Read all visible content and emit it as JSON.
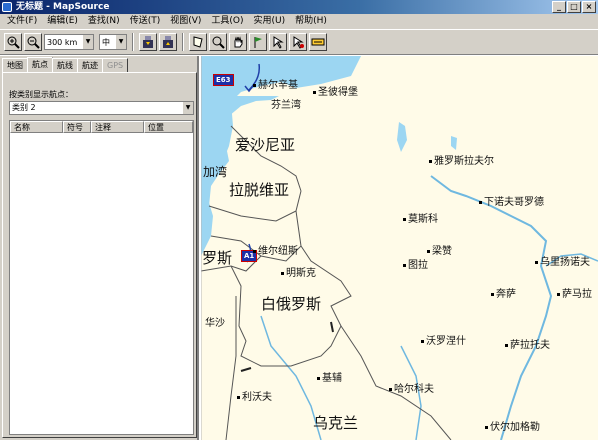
{
  "window": {
    "title": "无标题 - MapSource",
    "min": "_",
    "max": "□",
    "close": "×"
  },
  "menu": [
    "文件(F)",
    "编辑(E)",
    "查找(N)",
    "传送(T)",
    "视图(V)",
    "工具(O)",
    "实用(U)",
    "帮助(H)"
  ],
  "toolbar": {
    "zoom_value": "300 km",
    "detail_value": "中",
    "icons": [
      "zoom-in-icon",
      "zoom-out-icon",
      "receive-icon",
      "send-icon",
      "map-tool-icon",
      "zoom-tool-icon",
      "hand-tool-icon",
      "waypoint-tool-icon",
      "route-tool-icon",
      "measure-tool-icon",
      "map-info-icon"
    ]
  },
  "tabs": [
    {
      "label": "地图",
      "active": false,
      "disabled": false
    },
    {
      "label": "航点",
      "active": true,
      "disabled": false
    },
    {
      "label": "航线",
      "active": false,
      "disabled": false
    },
    {
      "label": "航迹",
      "active": false,
      "disabled": false
    },
    {
      "label": "GPS",
      "active": false,
      "disabled": true
    }
  ],
  "waypoints_panel": {
    "group_label": "按类别显示航点：",
    "group_value": "类别 2",
    "columns": [
      "名称",
      "符号",
      "注释",
      "位置"
    ]
  },
  "map": {
    "colors": {
      "land": "#fffbe8",
      "water": "#9cd6f2",
      "border": "#555555",
      "frame": "#b7b7b7"
    },
    "labels": [
      {
        "text": "赫尔辛基"
      },
      {
        "text": "芬兰湾"
      },
      {
        "text": "圣彼得堡"
      },
      {
        "text": "爱沙尼亚"
      },
      {
        "text": "雅罗斯拉夫尔"
      },
      {
        "text": "加湾"
      },
      {
        "text": "拉脱维亚"
      },
      {
        "text": "下诺夫哥罗德"
      },
      {
        "text": "莫斯科"
      },
      {
        "text": "维尔纽斯"
      },
      {
        "text": "梁赞"
      },
      {
        "text": "罗斯"
      },
      {
        "text": "明斯克"
      },
      {
        "text": "图拉"
      },
      {
        "text": "乌里扬诺夫"
      },
      {
        "text": "白俄罗斯"
      },
      {
        "text": "奔萨"
      },
      {
        "text": "萨马拉"
      },
      {
        "text": "华沙"
      },
      {
        "text": "沃罗涅什"
      },
      {
        "text": "萨拉托夫"
      },
      {
        "text": "基辅"
      },
      {
        "text": "利沃夫"
      },
      {
        "text": "哈尔科夫"
      },
      {
        "text": "乌克兰"
      },
      {
        "text": "伏尔加格勒"
      }
    ],
    "shields": [
      {
        "text": "E63"
      },
      {
        "text": "A1"
      }
    ]
  }
}
